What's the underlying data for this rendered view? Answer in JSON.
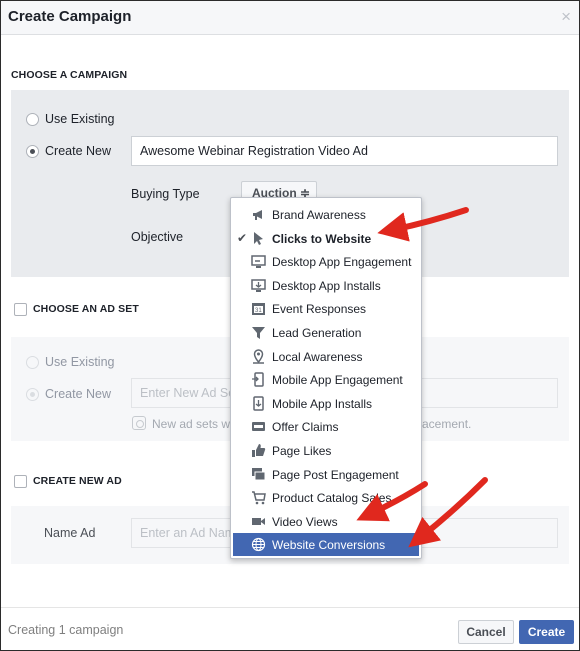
{
  "dialog": {
    "title": "Create Campaign",
    "close_glyph": "×"
  },
  "campaign": {
    "section_title": "CHOOSE A CAMPAIGN",
    "use_existing": "Use Existing",
    "create_new": "Create New",
    "name_value": "Awesome Webinar Registration Video Ad",
    "buying_type_label": "Buying Type",
    "buying_type_value": "Auction ≑",
    "objective_label": "Objective"
  },
  "adset": {
    "section_title": "CHOOSE AN AD SET",
    "use_existing": "Use Existing",
    "create_new": "Create New",
    "name_placeholder": "Enter New Ad Se",
    "hint_left": "New ad sets w",
    "hint_right": "acement."
  },
  "ad": {
    "section_title": "CREATE NEW AD",
    "name_label": "Name Ad",
    "name_placeholder": "Enter an Ad Nam"
  },
  "objective_menu": {
    "checked_item": "Clicks to Website",
    "highlighted_item": "Website Conversions",
    "items": [
      {
        "label": "Brand Awareness",
        "icon": "megaphone-icon"
      },
      {
        "label": "Clicks to Website",
        "icon": "cursor-icon"
      },
      {
        "label": "Desktop App Engagement",
        "icon": "desktop-app-icon"
      },
      {
        "label": "Desktop App Installs",
        "icon": "desktop-install-icon"
      },
      {
        "label": "Event Responses",
        "icon": "calendar-icon"
      },
      {
        "label": "Lead Generation",
        "icon": "funnel-icon"
      },
      {
        "label": "Local Awareness",
        "icon": "map-pin-icon"
      },
      {
        "label": "Mobile App Engagement",
        "icon": "mobile-app-icon"
      },
      {
        "label": "Mobile App Installs",
        "icon": "mobile-install-icon"
      },
      {
        "label": "Offer Claims",
        "icon": "offer-icon"
      },
      {
        "label": "Page Likes",
        "icon": "thumbs-up-icon"
      },
      {
        "label": "Page Post Engagement",
        "icon": "post-engagement-icon"
      },
      {
        "label": "Product Catalog Sales",
        "icon": "cart-icon"
      },
      {
        "label": "Video Views",
        "icon": "video-camera-icon"
      },
      {
        "label": "Website Conversions",
        "icon": "globe-icon"
      }
    ]
  },
  "footer": {
    "status": "Creating 1 campaign",
    "cancel": "Cancel",
    "create": "Create"
  },
  "colors": {
    "brand_blue": "#4267b2",
    "annotation_red": "#e0281e",
    "panel_gray": "#e9ebee"
  }
}
